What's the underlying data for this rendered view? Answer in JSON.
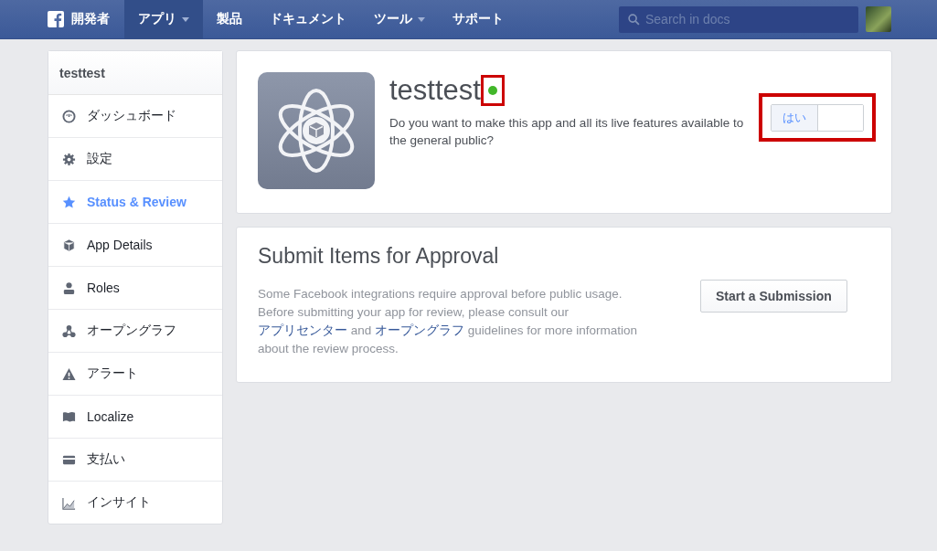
{
  "topbar": {
    "brand": "開発者",
    "nav": [
      {
        "label": "アプリ",
        "selected": true,
        "dropdown": true
      },
      {
        "label": "製品",
        "selected": false,
        "dropdown": false
      },
      {
        "label": "ドキュメント",
        "selected": false,
        "dropdown": false
      },
      {
        "label": "ツール",
        "selected": false,
        "dropdown": true
      },
      {
        "label": "サポート",
        "selected": false,
        "dropdown": false
      }
    ],
    "search": {
      "placeholder": "Search in docs"
    }
  },
  "sidebar": {
    "title": "testtest",
    "items": [
      {
        "label": "ダッシュボード",
        "selected": false
      },
      {
        "label": "設定",
        "selected": false
      },
      {
        "label": "Status & Review",
        "selected": true
      },
      {
        "label": "App Details",
        "selected": false
      },
      {
        "label": "Roles",
        "selected": false
      },
      {
        "label": "オープングラフ",
        "selected": false
      },
      {
        "label": "アラート",
        "selected": false
      },
      {
        "label": "Localize",
        "selected": false
      },
      {
        "label": "支払い",
        "selected": false
      },
      {
        "label": "インサイト",
        "selected": false
      }
    ]
  },
  "app_card": {
    "name": "testtest",
    "live": true,
    "question": "Do you want to make this app and all its live features available to the general public?",
    "toggle": {
      "label": "はい",
      "on": true
    }
  },
  "submit_card": {
    "title": "Submit Items for Approval",
    "description": [
      {
        "kind": "text",
        "text": "Some Facebook integrations require approval before public usage. Before submitting your app for review, please consult our "
      },
      {
        "kind": "link",
        "text": "アプリセンター"
      },
      {
        "kind": "text",
        "text": " and "
      },
      {
        "kind": "link",
        "text": "オープングラフ"
      },
      {
        "kind": "text",
        "text": " guidelines for more information about the review process."
      }
    ],
    "button": "Start a Submission"
  }
}
